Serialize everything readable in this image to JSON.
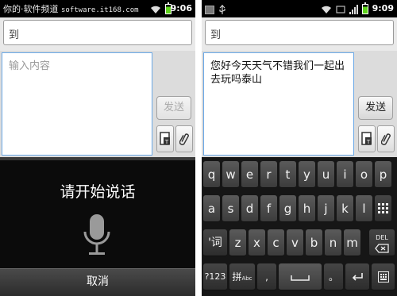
{
  "left_screen": {
    "statusbar": {
      "text": "你的·软件频道",
      "url": "software.it168.com",
      "time": "9:06"
    },
    "to_field": {
      "placeholder": "到"
    },
    "message": {
      "placeholder": "输入内容"
    },
    "send_label": "发送",
    "voice": {
      "prompt": "请开始说话",
      "cancel_label": "取消"
    }
  },
  "right_screen": {
    "statusbar": {
      "time": "9:09"
    },
    "to_field": {
      "placeholder": "到"
    },
    "message": {
      "value": "您好今天天气不错我们一起出去玩吗泰山"
    },
    "send_label": "发送",
    "keyboard": {
      "row1": [
        "q",
        "w",
        "e",
        "r",
        "t",
        "y",
        "u",
        "i",
        "o",
        "p"
      ],
      "row2": [
        "a",
        "s",
        "d",
        "f",
        "g",
        "h",
        "j",
        "k",
        "l"
      ],
      "row3": [
        "'词",
        "z",
        "x",
        "c",
        "v",
        "b",
        "n",
        "m"
      ],
      "delete_label": "DEL",
      "symbols_label": "?123",
      "ime_label": "拼",
      "ime_sub_label": "Abc",
      "comma_label": ",",
      "period_label": "。"
    }
  },
  "colors": {
    "accent_focus": "#6aa8e6",
    "battery": "#5fd31c",
    "keyboard_bg": "#161616"
  }
}
